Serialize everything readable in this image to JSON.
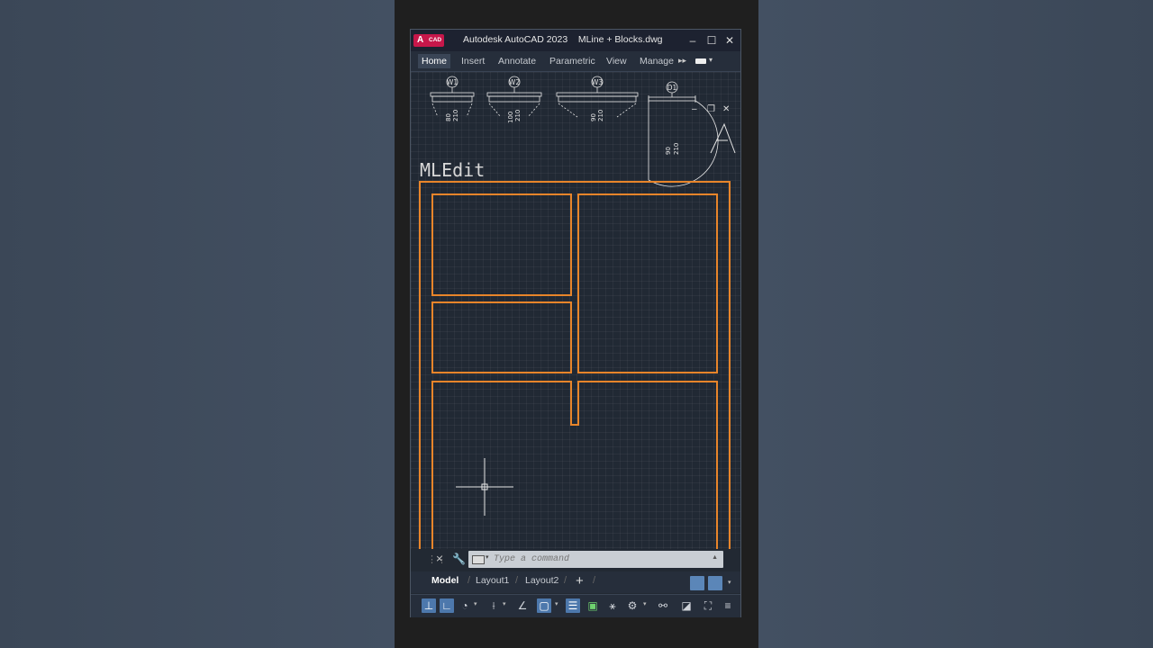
{
  "app": {
    "logo_letter": "A",
    "logo_text": "CAD",
    "title": "Autodesk AutoCAD 2023    MLine + Blocks.dwg"
  },
  "window_controls": {
    "minimize": "–",
    "maximize": "☐",
    "close": "✕"
  },
  "ribbon": {
    "tabs": [
      "Home",
      "Insert",
      "Annotate",
      "Parametric",
      "View",
      "Manage"
    ],
    "active_tab": "Home",
    "overflow": "▸▸"
  },
  "drawing": {
    "blocks": [
      {
        "tag": "W1",
        "dims": [
          "80",
          "210"
        ]
      },
      {
        "tag": "W2",
        "dims": [
          "100",
          "210"
        ]
      },
      {
        "tag": "W3",
        "dims": [
          "90",
          "210"
        ]
      },
      {
        "tag": "D1",
        "dims": [
          "90",
          "210"
        ]
      }
    ],
    "heading": "MLEdit",
    "viewport_controls": {
      "minimize": "–",
      "restore": "❐",
      "close": "✕"
    },
    "wall_color": "#e8852a",
    "background_color": "#212934"
  },
  "command_line": {
    "placeholder": "Type a command"
  },
  "layouts": {
    "tabs": [
      "Model",
      "Layout1",
      "Layout2"
    ],
    "active": "Model",
    "add": "+"
  },
  "status_bar": {
    "icons": [
      "model-space-icon",
      "snap-icon",
      "polar-icon",
      "osnap-tracking-icon",
      "angle-icon",
      "selection-cycling-icon",
      "lineweight-icon",
      "transparency-icon",
      "annotation-scale-icon",
      "gear-icon",
      "isolate-icon",
      "graphics-icon",
      "fullscreen-icon",
      "customize-icon"
    ],
    "accent_color": "#4d78ac"
  }
}
